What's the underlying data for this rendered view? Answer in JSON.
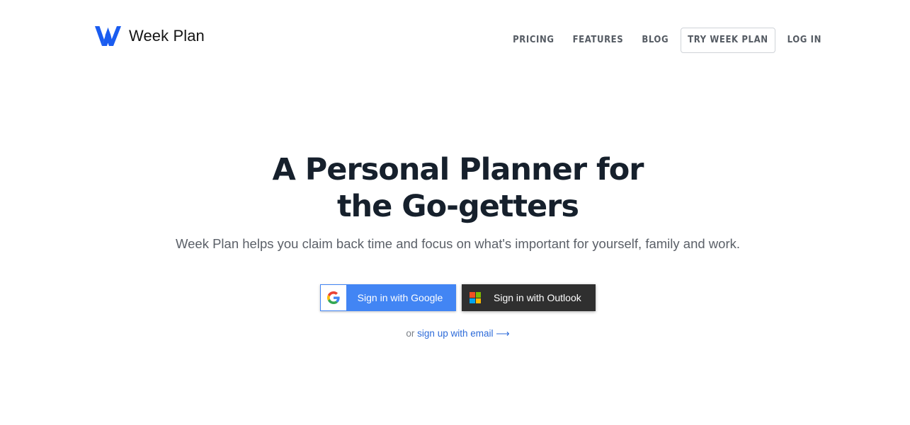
{
  "brand": {
    "name": "Week Plan",
    "logo_color": "#1a5cf0"
  },
  "nav": {
    "items": [
      {
        "label": "PRICING"
      },
      {
        "label": "FEATURES"
      },
      {
        "label": "BLOG"
      },
      {
        "label": "TRY WEEK PLAN"
      },
      {
        "label": "LOG IN"
      }
    ]
  },
  "hero": {
    "title_line1": "A Personal Planner for",
    "title_line2": "the Go-getters",
    "subtitle": "Week Plan helps you claim back time and focus on what's important for yourself, family and work."
  },
  "signin": {
    "google_label": "Sign in with Google",
    "google_color": "#4285f4",
    "outlook_label": "Sign in with Outlook",
    "outlook_color": "#2f2f2f"
  },
  "alt_signup": {
    "prefix": "or",
    "link_text": "sign up with email",
    "arrow": "⟶"
  }
}
